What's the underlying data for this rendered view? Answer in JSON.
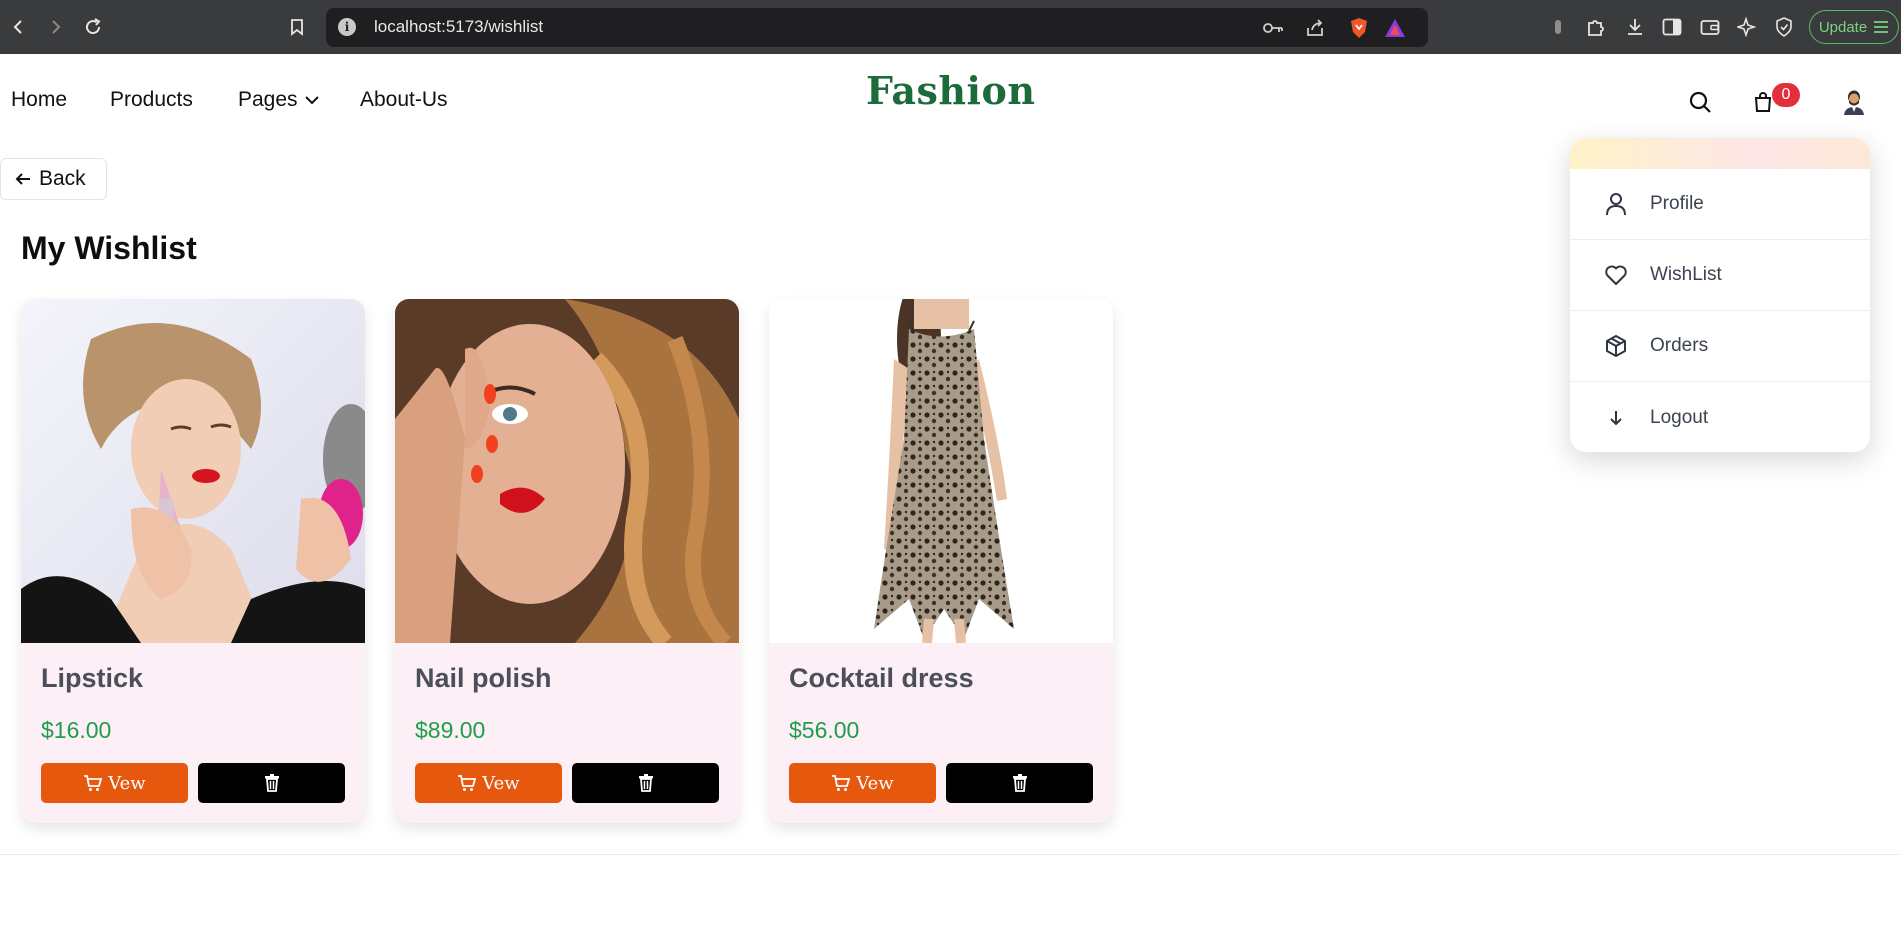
{
  "browser": {
    "url": "localhost:5173/wishlist",
    "update_label": "Update"
  },
  "header": {
    "nav": [
      "Home",
      "Products",
      "Pages",
      "About-Us"
    ],
    "logo": "Fashion",
    "cart_count": "0"
  },
  "back_label": "Back",
  "page_title": "My Wishlist",
  "products": [
    {
      "name": "Lipstick",
      "price": "$16.00",
      "view_label": "Vew"
    },
    {
      "name": "Nail polish",
      "price": "$89.00",
      "view_label": "Vew"
    },
    {
      "name": "Cocktail dress",
      "price": "$56.00",
      "view_label": "Vew"
    }
  ],
  "account_menu": {
    "items": [
      {
        "label": "Profile",
        "icon": "user-icon"
      },
      {
        "label": "WishList",
        "icon": "heart-icon"
      },
      {
        "label": "Orders",
        "icon": "package-icon"
      },
      {
        "label": "Logout",
        "icon": "arrow-down-icon"
      }
    ]
  },
  "colors": {
    "brand_green": "#1c6b3a",
    "view_orange": "#e6580e",
    "price_green": "#1e9e4a",
    "card_pink": "#fcf0f6",
    "badge_red": "#e0303e"
  }
}
